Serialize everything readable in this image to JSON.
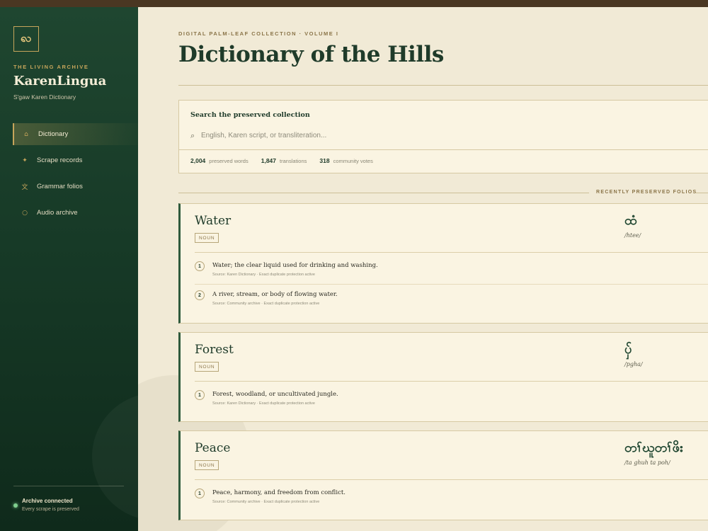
{
  "sidebar": {
    "logo_glyph": "ꩮ",
    "eyebrow": "THE LIVING ARCHIVE",
    "brand": "KarenLingua",
    "subtitle": "S'gaw Karen Dictionary",
    "nav": [
      {
        "label": "Dictionary",
        "icon": "home-icon",
        "glyph": "⌂",
        "active": true
      },
      {
        "label": "Scrape records",
        "icon": "sparkle-icon",
        "glyph": "✦",
        "active": false
      },
      {
        "label": "Grammar folios",
        "icon": "script-glyph-icon",
        "glyph": "文",
        "active": false
      },
      {
        "label": "Audio archive",
        "icon": "dot-icon",
        "glyph": "○",
        "active": false
      }
    ],
    "status": {
      "title": "Archive connected",
      "subtitle": "Every scrape is preserved",
      "color": "#7fcf8f"
    }
  },
  "main": {
    "eyebrow": "DIGITAL PALM-LEAF COLLECTION · VOLUME I",
    "title": "Dictionary of the Hills",
    "search": {
      "title": "Search the preserved collection",
      "placeholder": "English, Karen script, or transliteration...",
      "value": ""
    },
    "stats": [
      {
        "value": "2,004",
        "label": "preserved words"
      },
      {
        "value": "1,847",
        "label": "translations"
      },
      {
        "value": "318",
        "label": "community votes"
      }
    ],
    "section_label": "RECENTLY PRESERVED FOLIOS"
  },
  "entries": [
    {
      "word": "Water",
      "pos": "NOUN",
      "karen": "ထံ",
      "translit": "/htee/",
      "senses": [
        {
          "num": "1",
          "text": "Water; the clear liquid used for drinking and washing.",
          "source": "Source: Karen Dictionary · Exact duplicate protection active"
        },
        {
          "num": "2",
          "text": "A river, stream, or body of flowing water.",
          "source": "Source: Community archive · Exact duplicate protection active"
        }
      ]
    },
    {
      "word": "Forest",
      "pos": "NOUN",
      "karen": "ပှ်",
      "translit": "/pgha/",
      "senses": [
        {
          "num": "1",
          "text": "Forest, woodland, or uncultivated jungle.",
          "source": "Source: Karen Dictionary · Exact duplicate protection active"
        }
      ]
    },
    {
      "word": "Peace",
      "pos": "NOUN",
      "karen": "တၢ်ဃူတၢ်ဖိး",
      "translit": "/ta ghuh ta poh/",
      "senses": [
        {
          "num": "1",
          "text": "Peace, harmony, and freedom from conflict.",
          "source": "Source: Community archive · Exact duplicate protection active"
        }
      ]
    }
  ],
  "colors": {
    "accent_gold": "#c6a55b",
    "forest_green": "#1f4630",
    "parchment": "#faf4e2"
  }
}
